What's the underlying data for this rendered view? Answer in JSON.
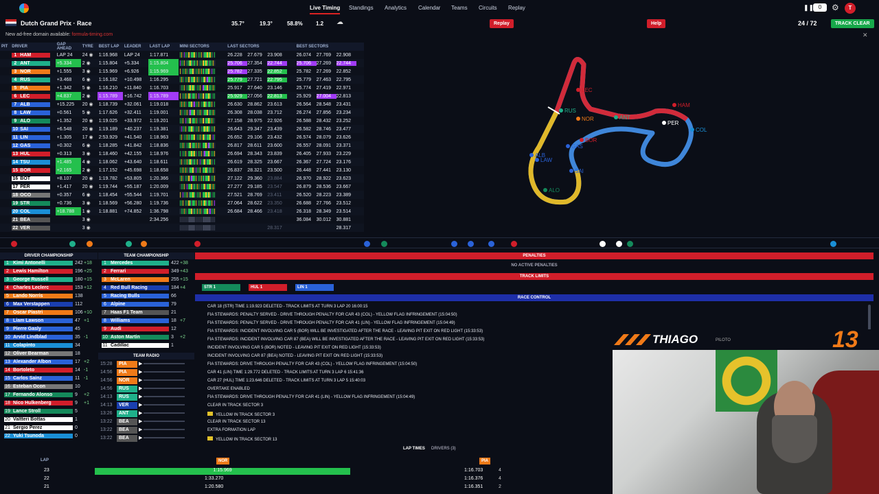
{
  "nav": {
    "live": "Live Timing",
    "standings": "Standings",
    "analytics": "Analytics",
    "calendar": "Calendar",
    "teams": "Teams",
    "circuits": "Circuits",
    "replay": "Replay",
    "counter": "0",
    "avatar": "T"
  },
  "session": {
    "title": "Dutch Grand Prix · Race",
    "air_temp": "35.7°",
    "track_temp": "19.3°",
    "humidity": "58.8%",
    "wind": "1.2",
    "replay_btn": "Replay",
    "help_btn": "Help",
    "laps": "24 / 72",
    "track_status": "TRACK CLEAR"
  },
  "notice": {
    "text": "New ad-free domain available:",
    "link": "formula-timing.com"
  },
  "timing": {
    "headers": [
      "PIT",
      "DRIVER",
      "GAP AHEAD",
      "TYRE",
      "BEST LAP",
      "LEADER",
      "LAST LAP",
      "MINI SECTORS",
      "LAST SECTORS",
      "BEST SECTORS"
    ],
    "rows": [
      {
        "pos": "1",
        "drv": "HAM",
        "c": "#d11e2a",
        "gap": "LAP 24",
        "tyre": "24",
        "best": "1:16.968",
        "leader": "LAP 24",
        "last": "1:17.871",
        "ls": [
          "26.228",
          "27.679",
          "23.908"
        ],
        "bs": [
          "26.074",
          "27.769",
          "22.908"
        ]
      },
      {
        "pos": "2",
        "drv": "ANT",
        "c": "#1fb08a",
        "gap": "+5.334",
        "tyre": "2",
        "best": "1:15.804",
        "leader": "+5.334",
        "last": "1:15.804",
        "ls": [
          "25.706",
          "27.354",
          "22.744"
        ],
        "bs": [
          "25.706",
          "27.269",
          "22.744"
        ]
      },
      {
        "pos": "3",
        "drv": "NOR",
        "c": "#f07a18",
        "gap": "+1.555",
        "tyre": "3",
        "best": "1:15.969",
        "leader": "+6.926",
        "last": "1:15.969",
        "ls": [
          "25.782",
          "27.335",
          "22.852"
        ],
        "bs": [
          "25.782",
          "27.269",
          "22.852"
        ]
      },
      {
        "pos": "4",
        "drv": "RUS",
        "c": "#1fb08a",
        "gap": "+3.468",
        "tyre": "6",
        "best": "1:16.182",
        "leader": "+10.498",
        "last": "1:16.295",
        "ls": [
          "25.779",
          "27.721",
          "22.795"
        ],
        "bs": [
          "25.779",
          "27.463",
          "22.795"
        ]
      },
      {
        "pos": "5",
        "drv": "PIA",
        "c": "#f07a18",
        "gap": "+1.342",
        "tyre": "5",
        "best": "1:16.210",
        "leader": "+11.840",
        "last": "1:16.703",
        "ls": [
          "25.917",
          "27.640",
          "23.146"
        ],
        "bs": [
          "25.774",
          "27.419",
          "22.971"
        ]
      },
      {
        "pos": "6",
        "drv": "LEC",
        "c": "#d11e2a",
        "gap": "+4.837",
        "tyre": "2",
        "best": "1:15.789",
        "leader": "+16.742",
        "last": "1:15.789",
        "ls": [
          "25.929",
          "27.056",
          "22.813"
        ],
        "bs": [
          "25.929",
          "27.004",
          "22.813"
        ]
      },
      {
        "pos": "7",
        "drv": "ALB",
        "c": "#2a62d8",
        "gap": "+15.225",
        "tyre": "20",
        "best": "1:18.739",
        "leader": "+32.061",
        "last": "1:19.018",
        "ls": [
          "26.630",
          "28.862",
          "23.613"
        ],
        "bs": [
          "26.564",
          "28.548",
          "23.431"
        ]
      },
      {
        "pos": "8",
        "drv": "LAW",
        "c": "#2a62d8",
        "gap": "+0.561",
        "tyre": "5",
        "best": "1:17.626",
        "leader": "+32.411",
        "last": "1:19.001",
        "ls": [
          "26.308",
          "28.038",
          "23.712"
        ],
        "bs": [
          "26.274",
          "27.856",
          "23.234"
        ]
      },
      {
        "pos": "9",
        "drv": "ALO",
        "c": "#148a5b",
        "gap": "+1.352",
        "tyre": "20",
        "best": "1:19.025",
        "leader": "+33.972",
        "last": "1:19.201",
        "ls": [
          "27.158",
          "28.975",
          "22.926"
        ],
        "bs": [
          "26.588",
          "28.432",
          "23.252"
        ]
      },
      {
        "pos": "10",
        "drv": "SAI",
        "c": "#2a62d8",
        "gap": "+6.548",
        "tyre": "20",
        "best": "1:19.189",
        "leader": "+40.237",
        "last": "1:19.381",
        "ls": [
          "26.643",
          "29.347",
          "23.439"
        ],
        "bs": [
          "26.582",
          "28.746",
          "23.477"
        ]
      },
      {
        "pos": "11",
        "drv": "LIN",
        "c": "#2a62d8",
        "gap": "+1.305",
        "tyre": "17",
        "best": "2:53.929",
        "leader": "+41.540",
        "last": "1:18.963",
        "ls": [
          "26.652",
          "29.106",
          "23.432"
        ],
        "bs": [
          "26.574",
          "28.079",
          "23.626"
        ]
      },
      {
        "pos": "12",
        "drv": "GAS",
        "c": "#2a62d8",
        "gap": "+0.302",
        "tyre": "6",
        "best": "1:18.285",
        "leader": "+41.842",
        "last": "1:18.836",
        "ls": [
          "26.817",
          "28.611",
          "23.600"
        ],
        "bs": [
          "26.557",
          "28.091",
          "23.371"
        ]
      },
      {
        "pos": "13",
        "drv": "HUL",
        "c": "#d11e2a",
        "gap": "+0.313",
        "tyre": "3",
        "best": "1:18.460",
        "leader": "+42.155",
        "last": "1:18.976",
        "ls": [
          "26.694",
          "28.343",
          "23.839"
        ],
        "bs": [
          "26.405",
          "27.933",
          "23.229"
        ]
      },
      {
        "pos": "14",
        "drv": "TSU",
        "c": "#1a8fd6",
        "gap": "+1.485",
        "tyre": "4",
        "best": "1:18.062",
        "leader": "+43.640",
        "last": "1:18.611",
        "ls": [
          "26.619",
          "28.325",
          "23.667"
        ],
        "bs": [
          "26.367",
          "27.724",
          "23.176"
        ]
      },
      {
        "pos": "15",
        "drv": "BOR",
        "c": "#d11e2a",
        "gap": "+2.165",
        "tyre": "2",
        "best": "1:17.152",
        "leader": "+45.698",
        "last": "1:18.658",
        "ls": [
          "26.837",
          "28.321",
          "23.500"
        ],
        "bs": [
          "26.448",
          "27.441",
          "23.130"
        ]
      },
      {
        "pos": "16",
        "drv": "BOT",
        "c": "#ffffff",
        "gap": "+8.107",
        "tyre": "20",
        "best": "1:19.782",
        "leader": "+53.805",
        "last": "1:20.366",
        "ls": [
          "27.122",
          "29.360",
          "23.884"
        ],
        "bs": [
          "26.970",
          "28.922",
          "23.623"
        ]
      },
      {
        "pos": "17",
        "drv": "PER",
        "c": "#ffffff",
        "gap": "+1.417",
        "tyre": "20",
        "best": "1:19.744",
        "leader": "+55.187",
        "last": "1:20.009",
        "ls": [
          "27.277",
          "29.185",
          "23.547"
        ],
        "bs": [
          "26.879",
          "28.536",
          "23.667"
        ]
      },
      {
        "pos": "18",
        "drv": "OCO",
        "c": "#777777",
        "gap": "+0.357",
        "tyre": "6",
        "best": "1:18.454",
        "leader": "+55.544",
        "last": "1:19.701",
        "ls": [
          "27.521",
          "28.769",
          "23.411"
        ],
        "bs": [
          "26.520",
          "28.223",
          "23.389"
        ]
      },
      {
        "pos": "19",
        "drv": "STR",
        "c": "#148a5b",
        "gap": "+0.736",
        "tyre": "3",
        "best": "1:18.569",
        "leader": "+56.280",
        "last": "1:19.736",
        "ls": [
          "27.064",
          "28.622",
          "23.350"
        ],
        "bs": [
          "26.688",
          "27.766",
          "23.512"
        ]
      },
      {
        "pos": "20",
        "drv": "COL",
        "c": "#1a8fd6",
        "gap": "+18.788",
        "tyre": "1",
        "best": "1:18.881",
        "leader": "+74.852",
        "last": "1:36.798",
        "ls": [
          "26.684",
          "28.466",
          "23.418"
        ],
        "bs": [
          "26.318",
          "28.349",
          "23.514"
        ]
      },
      {
        "pos": "21",
        "drv": "BEA",
        "c": "#555555",
        "gap": "",
        "tyre": "3",
        "best": "",
        "leader": "",
        "last": "2:34.256",
        "ls": [
          "",
          "",
          ""
        ],
        "bs": [
          "36.084",
          "30.012",
          "30.881"
        ]
      },
      {
        "pos": "22",
        "drv": "VER",
        "c": "#555555",
        "gap": "",
        "tyre": "3",
        "best": "",
        "leader": "",
        "last": "",
        "ls": [
          "",
          "",
          "28.317"
        ],
        "bs": [
          "",
          "",
          "28.317"
        ]
      }
    ]
  },
  "map": {
    "labels": [
      "LEC",
      "HAM",
      "RUS",
      "NOR",
      "ANT",
      "PER",
      "COL",
      "GAS",
      "BOR",
      "LAW",
      "ALB",
      "SAI",
      "ALO"
    ]
  },
  "driver_champ": {
    "title": "DRIVER CHAMPIONSHIP",
    "rows": [
      {
        "p": "1",
        "n": "Kimi Antonelli",
        "c": "#1fb08a",
        "pts": "242",
        "d": "+18"
      },
      {
        "p": "2",
        "n": "Lewis Hamilton",
        "c": "#d11e2a",
        "pts": "196",
        "d": "+25"
      },
      {
        "p": "3",
        "n": "George Russell",
        "c": "#1fb08a",
        "pts": "180",
        "d": "+15"
      },
      {
        "p": "4",
        "n": "Charles Leclerc",
        "c": "#d11e2a",
        "pts": "153",
        "d": "+12"
      },
      {
        "p": "5",
        "n": "Lando Norris",
        "c": "#f07a18",
        "pts": "138",
        "d": ""
      },
      {
        "p": "6",
        "n": "Max Verstappen",
        "c": "#1a3fb0",
        "pts": "112",
        "d": ""
      },
      {
        "p": "7",
        "n": "Oscar Piastri",
        "c": "#f07a18",
        "pts": "106",
        "d": "+10"
      },
      {
        "p": "8",
        "n": "Liam Lawson",
        "c": "#2a62d8",
        "pts": "47",
        "d": "+1"
      },
      {
        "p": "9",
        "n": "Pierre Gasly",
        "c": "#2a62d8",
        "pts": "45",
        "d": ""
      },
      {
        "p": "10",
        "n": "Arvid Lindblad",
        "c": "#2a62d8",
        "pts": "35",
        "d": "-1"
      },
      {
        "p": "11",
        "n": "Colapinto",
        "c": "#1a8fd6",
        "pts": "34",
        "d": ""
      },
      {
        "p": "12",
        "n": "Oliver Bearman",
        "c": "#777777",
        "pts": "18",
        "d": ""
      },
      {
        "p": "13",
        "n": "Alexander Albon",
        "c": "#2a62d8",
        "pts": "17",
        "d": "+2"
      },
      {
        "p": "14",
        "n": "Bortoleto",
        "c": "#d11e2a",
        "pts": "14",
        "d": "-1"
      },
      {
        "p": "15",
        "n": "Carlos Sainz",
        "c": "#2a62d8",
        "pts": "11",
        "d": "-1"
      },
      {
        "p": "16",
        "n": "Esteban Ocon",
        "c": "#777777",
        "pts": "10",
        "d": ""
      },
      {
        "p": "17",
        "n": "Fernando Alonso",
        "c": "#148a5b",
        "pts": "9",
        "d": "+2"
      },
      {
        "p": "18",
        "n": "Nico Hulkenberg",
        "c": "#d11e2a",
        "pts": "9",
        "d": "+1"
      },
      {
        "p": "19",
        "n": "Lance Stroll",
        "c": "#148a5b",
        "pts": "5",
        "d": ""
      },
      {
        "p": "20",
        "n": "Valtteri Bottas",
        "c": "#ffffff",
        "pts": "1",
        "d": ""
      },
      {
        "p": "21",
        "n": "Sergio Perez",
        "c": "#ffffff",
        "pts": "0",
        "d": ""
      },
      {
        "p": "22",
        "n": "Yuki Tsunoda",
        "c": "#1a8fd6",
        "pts": "0",
        "d": ""
      }
    ]
  },
  "team_champ": {
    "title": "TEAM CHAMPIONSHIP",
    "rows": [
      {
        "p": "1",
        "n": "Mercedes",
        "c": "#1fb08a",
        "pts": "422",
        "d": "+38"
      },
      {
        "p": "2",
        "n": "Ferrari",
        "c": "#d11e2a",
        "pts": "349",
        "d": "+43"
      },
      {
        "p": "3",
        "n": "McLaren",
        "c": "#f07a18",
        "pts": "255",
        "d": "+15"
      },
      {
        "p": "4",
        "n": "Red Bull Racing",
        "c": "#1a3fb0",
        "pts": "184",
        "d": "+4"
      },
      {
        "p": "5",
        "n": "Racing Bulls",
        "c": "#2a62d8",
        "pts": "66",
        "d": ""
      },
      {
        "p": "6",
        "n": "Alpine",
        "c": "#2a62d8",
        "pts": "79",
        "d": ""
      },
      {
        "p": "7",
        "n": "Haas F1 Team",
        "c": "#555555",
        "pts": "21",
        "d": ""
      },
      {
        "p": "8",
        "n": "Williams",
        "c": "#2a62d8",
        "pts": "18",
        "d": "+7"
      },
      {
        "p": "9",
        "n": "Audi",
        "c": "#d11e2a",
        "pts": "12",
        "d": ""
      },
      {
        "p": "10",
        "n": "Aston Martin",
        "c": "#148a5b",
        "pts": "3",
        "d": "+2"
      },
      {
        "p": "11",
        "n": "Cadillac",
        "c": "#ffffff",
        "pts": "1",
        "d": ""
      }
    ]
  },
  "radio": {
    "title": "TEAM RADIO",
    "rows": [
      {
        "t": "15:28",
        "d": "PIA",
        "c": "#f07a18"
      },
      {
        "t": "14:56",
        "d": "PIA",
        "c": "#f07a18"
      },
      {
        "t": "14:56",
        "d": "NOR",
        "c": "#f07a18"
      },
      {
        "t": "14:56",
        "d": "RUS",
        "c": "#1fb08a"
      },
      {
        "t": "14:13",
        "d": "RUS",
        "c": "#1fb08a"
      },
      {
        "t": "14:13",
        "d": "VER",
        "c": "#1a3fb0"
      },
      {
        "t": "13:26",
        "d": "ANT",
        "c": "#1fb08a"
      },
      {
        "t": "13:22",
        "d": "BEA",
        "c": "#555555"
      },
      {
        "t": "13:22",
        "d": "BEA",
        "c": "#555555"
      },
      {
        "t": "13:22",
        "d": "BEA",
        "c": "#555555"
      }
    ]
  },
  "penalties": {
    "title": "PENALTIES",
    "empty": "NO ACTIVE PENALTIES"
  },
  "track_limits": {
    "title": "TRACK LIMITS",
    "tags": [
      {
        "d": "STR",
        "n": "1",
        "c": "#148a5b"
      },
      {
        "d": "HUL",
        "n": "1",
        "c": "#d11e2a"
      },
      {
        "d": "LIN",
        "n": "1",
        "c": "#2a62d8"
      }
    ]
  },
  "race_control": {
    "title": "RACE CONTROL",
    "messages": [
      "CAR 18 (STR) TIME 1:19.923 DELETED - TRACK LIMITS AT TURN 3 LAP 20 16:00:15",
      "FIA STEWARDS: PENALTY SERVED - DRIVE THROUGH PENALTY FOR CAR 43 (COL) - YELLOW FLAG INFRINGEMENT (15:04:50)",
      "FIA STEWARDS: PENALTY SERVED - DRIVE THROUGH PENALTY FOR CAR 41 (LIN) - YELLOW FLAG INFRINGEMENT (15:04:49)",
      "FIA STEWARDS: INCIDENT INVOLVING CAR 5 (BOR) WILL BE INVESTIGATED AFTER THE RACE - LEAVING PIT EXIT ON RED LIGHT (15:33:53)",
      "FIA STEWARDS: INCIDENT INVOLVING CAR 87 (BEA) WILL BE INVESTIGATED AFTER THE RACE - LEAVING PIT EXIT ON RED LIGHT (15:33:53)",
      "INCIDENT INVOLVING CAR 5 (BOR) NOTED - LEAVING PIT EXIT ON RED LIGHT (15:33:53)",
      "INCIDENT INVOLVING CAR 87 (BEA) NOTED - LEAVING PIT EXIT ON RED LIGHT (15:33:53)",
      "FIA STEWARDS: DRIVE THROUGH PENALTY FOR CAR 43 (COL) - YELLOW FLAG INFRINGEMENT (15:04:50)",
      "CAR 41 (LIN) TIME 1:29.772 DELETED - TRACK LIMITS AT TURN 3 LAP 6 15:41:36",
      "CAR 27 (HUL) TIME 1:23.646 DELETED - TRACK LIMITS AT TURN 3 LAP 5 15:40:03",
      "OVERTAKE ENABLED",
      "FIA STEWARDS: DRIVE THROUGH PENALTY FOR CAR 41 (LIN) - YELLOW FLAG INFRINGEMENT (15:04:49)",
      "CLEAR IN TRACK SECTOR 3",
      "YELLOW IN TRACK SECTOR 3",
      "CLEAR IN TRACK SECTOR 13",
      "EXTRA FORMATION LAP",
      "YELLOW IN TRACK SECTOR 13"
    ]
  },
  "laptimes": {
    "title": "LAP TIMES",
    "drivers_btn": "DRIVERS (3)",
    "lap_header": "LAP",
    "d1": "NOR",
    "d2": "PIA",
    "rows": [
      {
        "lap": "23",
        "a": "1:15.969",
        "b": "1:16.703",
        "bt": "4"
      },
      {
        "lap": "22",
        "a": "1:33.270",
        "b": "1:16.376",
        "bt": "4"
      },
      {
        "lap": "21",
        "a": "1:20.580",
        "b": "1:16.351",
        "bt": "2"
      }
    ]
  },
  "overlay": {
    "name": "THIAGO",
    "role": "PILOTO",
    "number": "13"
  },
  "colors": {
    "accent": "#d11e2a",
    "green": "#24c04d",
    "purple": "#a13bf5",
    "panel": "#0d111b"
  }
}
